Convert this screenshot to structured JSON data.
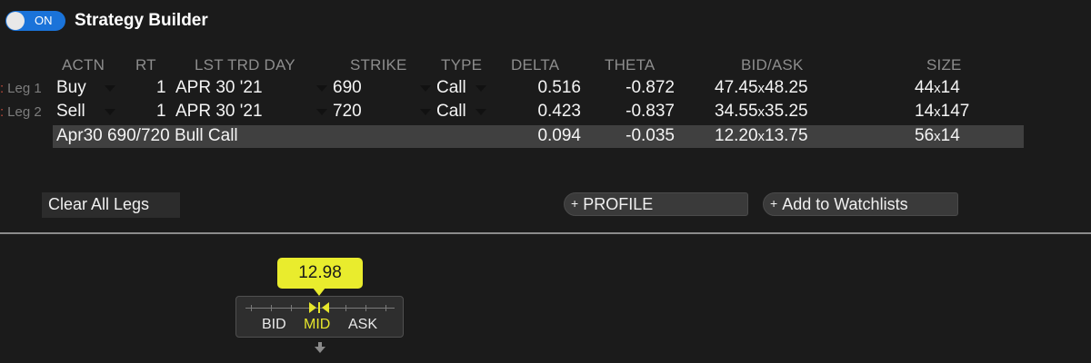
{
  "header": {
    "toggle_label": "ON",
    "title": "Strategy Builder"
  },
  "columns": {
    "actn": "ACTN",
    "rt": "RT",
    "lst_trd_day": "LST TRD DAY",
    "strike": "STRIKE",
    "type": "TYPE",
    "delta": "DELTA",
    "theta": "THETA",
    "bid_ask": "BID/ASK",
    "size": "SIZE"
  },
  "legs": [
    {
      "label": "Leg 1",
      "action": "Buy",
      "ratio": "1",
      "expiry": "APR 30 '21",
      "strike": "690",
      "type": "Call",
      "delta": "0.516",
      "theta": "-0.872",
      "bid": "47.45",
      "ask": "48.25",
      "size_bid": "44",
      "size_ask": "14"
    },
    {
      "label": "Leg 2",
      "action": "Sell",
      "ratio": "1",
      "expiry": "APR 30 '21",
      "strike": "720",
      "type": "Call",
      "delta": "0.423",
      "theta": "-0.837",
      "bid": "34.55",
      "ask": "35.25",
      "size_bid": "14",
      "size_ask": "147"
    }
  ],
  "summary": {
    "name": "Apr30 690/720 Bull Call",
    "delta": "0.094",
    "theta": "-0.035",
    "bid": "12.20",
    "ask": "13.75",
    "size_bid": "56",
    "size_ask": "14"
  },
  "separator": "x",
  "buttons": {
    "clear": "Clear All Legs",
    "profile": "PROFILE",
    "watchlists": "Add to Watchlists"
  },
  "price_slider": {
    "price": "12.98",
    "bid_label": "BID",
    "mid_label": "MID",
    "ask_label": "ASK",
    "selected": "MID"
  },
  "colors": {
    "accent": "#1a73d9",
    "highlight": "#e9ec2d",
    "summary_bg": "#404040"
  }
}
